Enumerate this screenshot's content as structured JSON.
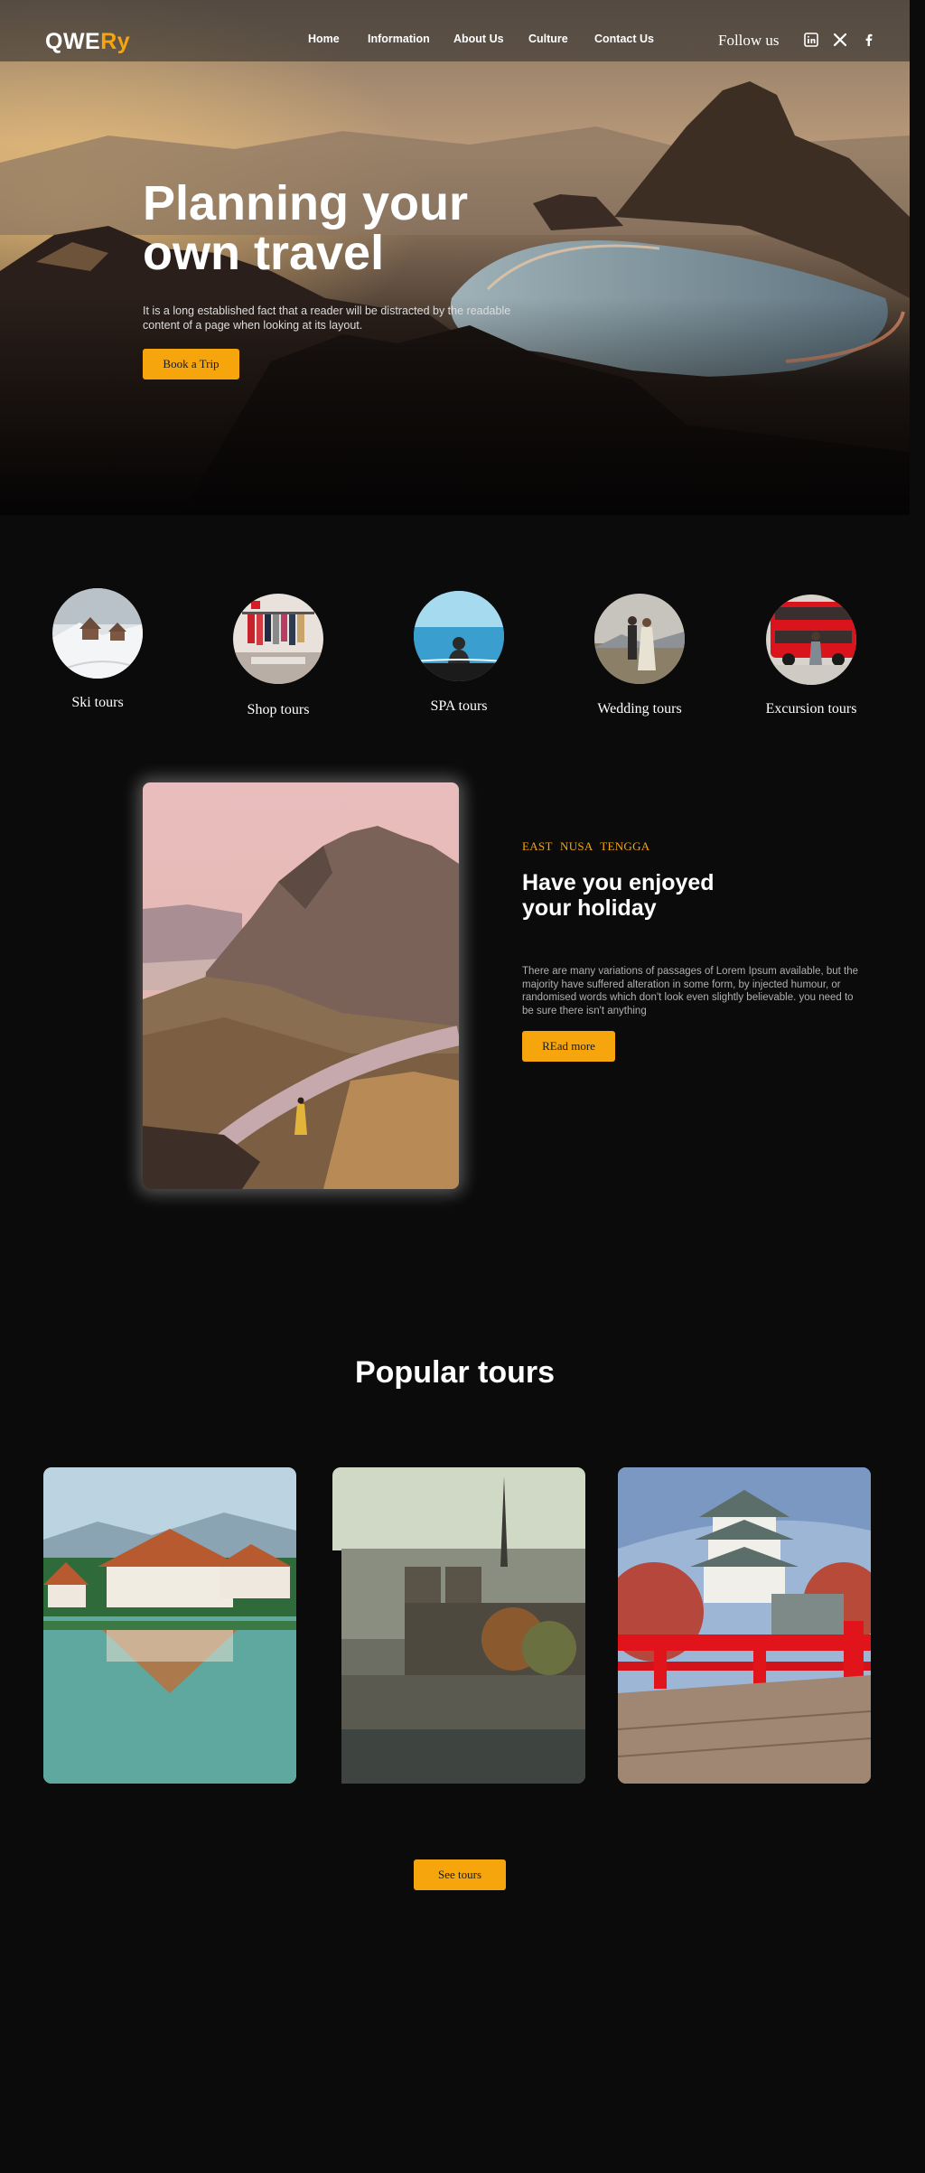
{
  "brand": {
    "logo_part1": "QWE",
    "logo_part2": "Ry",
    "accent_color": "#f6a50d"
  },
  "nav": {
    "items": [
      "Home",
      "Information",
      "About Us",
      "Culture",
      "Contact Us"
    ],
    "follow_label": "Follow us",
    "social_icons": [
      "linkedin-icon",
      "x-icon",
      "facebook-icon"
    ]
  },
  "hero": {
    "title_line1": "Planning your",
    "title_line2": "own travel",
    "text": "It is a long established fact that a reader will be distracted by the readable content of a page when looking at its layout.",
    "button": "Book a Trip"
  },
  "categories": [
    {
      "label": "Ski tours"
    },
    {
      "label": "Shop tours"
    },
    {
      "label": "SPA tours"
    },
    {
      "label": "Wedding tours"
    },
    {
      "label": "Excursion tours"
    }
  ],
  "feature": {
    "eyebrow": "EAST NUSA TENGGA",
    "title_line1": "Have you enjoyed",
    "title_line2": "your holiday",
    "text": "There are many variations of passages of Lorem Ipsum available, but the majority have suffered alteration in some form, by injected humour, or randomised words which don't look even slightly believable. you need to be sure there isn't anything",
    "button": "REad more"
  },
  "popular": {
    "title": "Popular tours",
    "button": "See tours"
  }
}
